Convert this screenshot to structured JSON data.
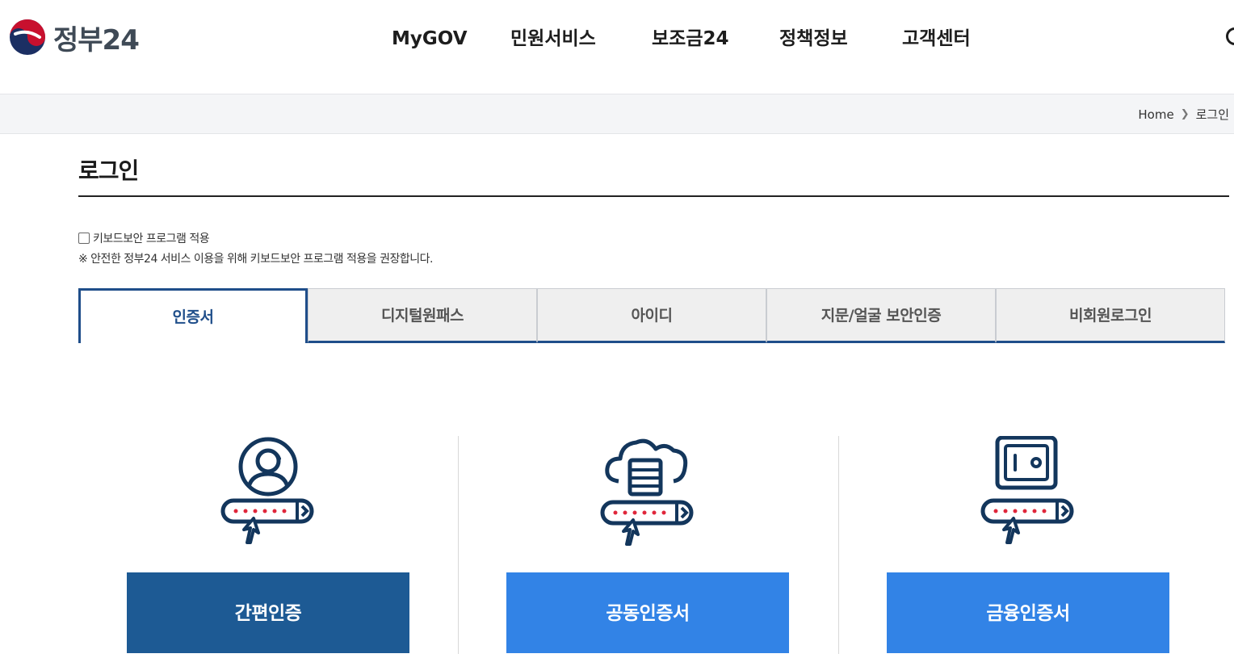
{
  "header": {
    "logo_text": "정부24",
    "nav": [
      "MyGOV",
      "민원서비스",
      "보조금24",
      "정책정보",
      "고객센터"
    ]
  },
  "breadcrumb": {
    "home": "Home",
    "current": "로그인"
  },
  "page": {
    "title": "로그인"
  },
  "keyboard_security": {
    "checkbox_label": "키보드보안 프로그램 적용",
    "checked": false,
    "note": "※ 안전한 정부24 서비스 이용을 위해 키보드보안 프로그램 적용을 권장합니다."
  },
  "tabs": [
    {
      "label": "인증서",
      "active": true
    },
    {
      "label": "디지털원패스",
      "active": false
    },
    {
      "label": "아이디",
      "active": false
    },
    {
      "label": "지문/얼굴 보안인증",
      "active": false
    },
    {
      "label": "비회원로그인",
      "active": false
    }
  ],
  "methods": [
    {
      "icon": "person-login-icon",
      "button": "간편인증",
      "color": "#1d5a94"
    },
    {
      "icon": "cloud-server-login-icon",
      "button": "공동인증서",
      "color": "#3283e6"
    },
    {
      "icon": "safe-login-icon",
      "button": "금융인증서",
      "color": "#3283e6"
    }
  ],
  "colors": {
    "brand_navy": "#1f4e8a",
    "icon_navy": "#13365c",
    "password_dots": "#e0263a",
    "primary_button": "#1d5a94",
    "secondary_button": "#3283e6"
  }
}
